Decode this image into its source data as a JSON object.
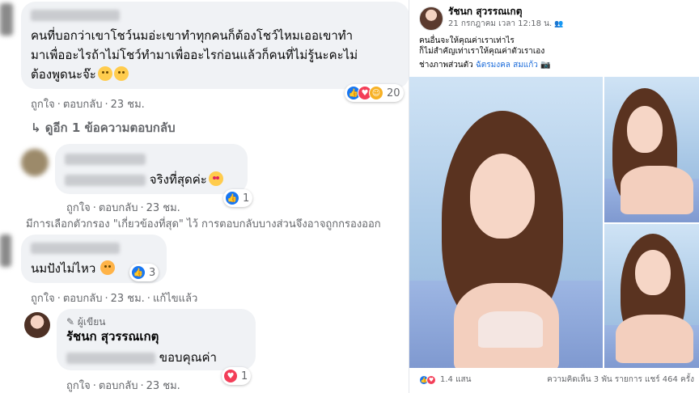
{
  "comments": [
    {
      "text_lines": [
        "คนที่บอกว่าเขาโชว์นมอ่ะเขาทำทุกคนก็ต้องโชว์ไหมเออเขาทำ",
        "มาเพื่ออะไรถ้าไม่โชว์ทำมาเพื่ออะไรก่อนแล้วก็คนที่ไม่รู้นะคะไม่",
        "ต้องพูดนะจ๊ะ"
      ],
      "actions": {
        "like": "ถูกใจ",
        "reply": "ตอบกลับ",
        "time": "23 ชม."
      },
      "reaction_count": "20"
    },
    {
      "text": "จริงที่สุดค่ะ",
      "actions": {
        "like": "ถูกใจ",
        "reply": "ตอบกลับ",
        "time": "23 ชม."
      },
      "reaction_count": "1"
    },
    {
      "text": "นมปังไม่ไหว",
      "actions": {
        "like": "ถูกใจ",
        "reply": "ตอบกลับ",
        "time": "23 ชม.",
        "edited": "แก้ไขแล้ว"
      },
      "reaction_count": "3"
    },
    {
      "badge": "ผู้เขียน",
      "author": "รัชนก สุวรรณเกตุ",
      "text": "ขอบคุณค่า",
      "actions": {
        "like": "ถูกใจ",
        "reply": "ตอบกลับ",
        "time": "23 ชม."
      },
      "reaction_count": "1"
    }
  ],
  "more_replies": "ดูอีก 1 ข้อความตอบกลับ",
  "filter_note": "มีการเลือกตัวกรอง \"เกี่ยวข้องที่สุด\" ไว้ การตอบกลับบางส่วนจึงอาจถูกกรองออก",
  "post": {
    "author": "รัชนก สุวรรณเกตุ",
    "time": "21 กรกฎาคม เวลา 12:18 น.",
    "caption_lines": [
      "คนอื่นจะให้คุณค่าเราเท่าไร",
      "ก็ไม่สำคัญเท่าเราให้คุณค่าตัวเราเอง"
    ],
    "credit_prefix": "ช่างภาพส่วนตัว",
    "credit_link": "ฉัตรมงคล สมแก้ว",
    "reactions_count": "1.4 แสน",
    "stats": "ความคิดเห็น 3 พัน รายการ  แชร์ 464 ครั้ง"
  },
  "colors": {
    "link": "#216fdb",
    "like": "#1877f2",
    "love": "#f33e58",
    "muted": "#65676b"
  }
}
